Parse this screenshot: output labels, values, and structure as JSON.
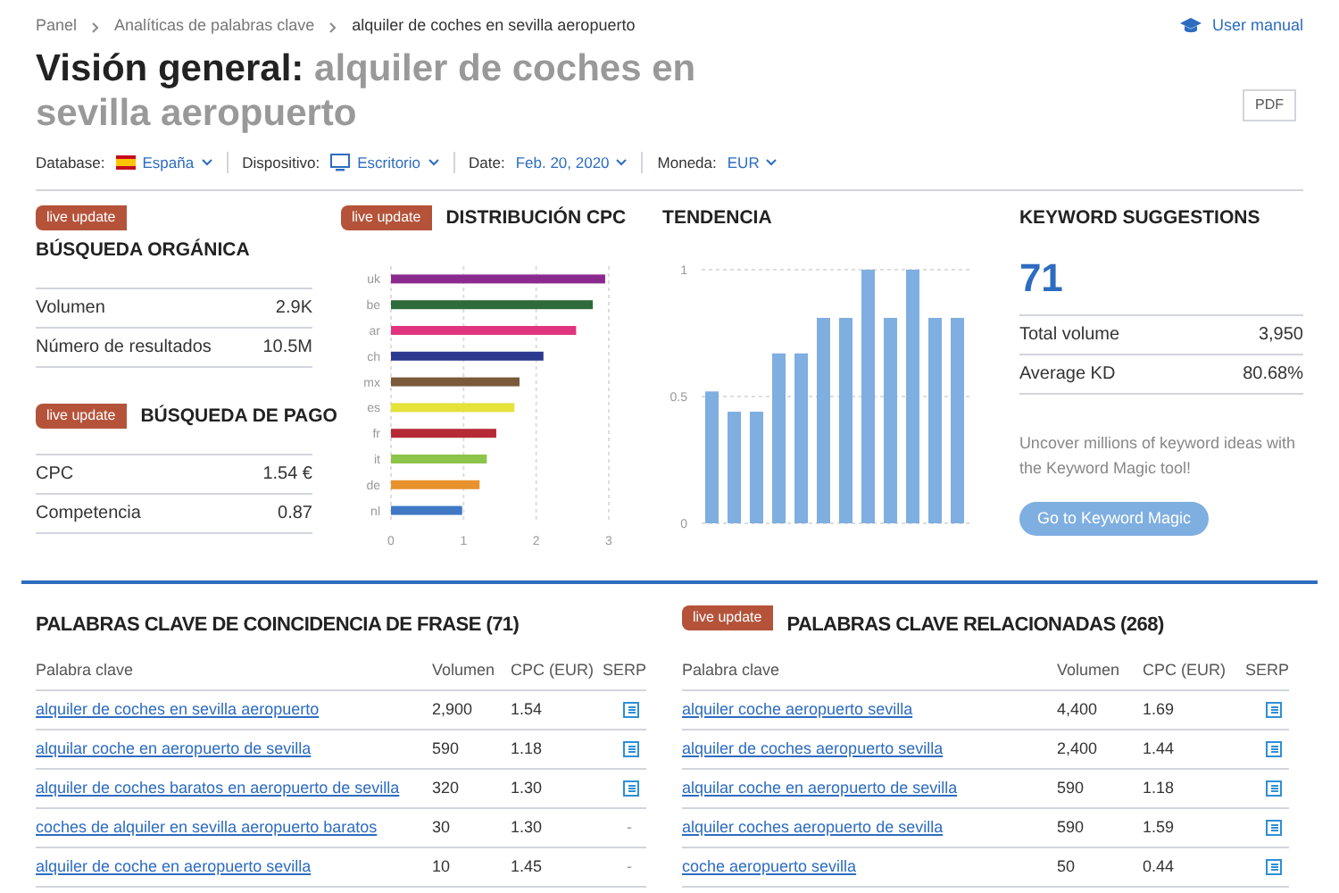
{
  "breadcrumb": [
    "Panel",
    "Analíticas de palabras clave",
    "alquiler de coches en sevilla aeropuerto"
  ],
  "user_manual": "User manual",
  "title": {
    "prefix": "Visión general:",
    "keyword": "alquiler de coches en sevilla aeropuerto"
  },
  "pdf_button": "PDF",
  "filters": [
    {
      "label": "Database:",
      "value": "España",
      "kind": "flag"
    },
    {
      "label": "Dispositivo:",
      "value": "Escritorio",
      "kind": "desktop"
    },
    {
      "label": "Date:",
      "value": "Feb. 20, 2020",
      "kind": "plain"
    },
    {
      "label": "Moneda:",
      "value": "EUR",
      "kind": "plain"
    }
  ],
  "organic": {
    "badge": "live update",
    "title": "BÚSQUEDA ORGÁNICA",
    "rows": [
      {
        "label": "Volumen",
        "value": "2.9K"
      },
      {
        "label": "Número de resultados",
        "value": "10.5M"
      }
    ]
  },
  "paid": {
    "badge": "live update",
    "title": "BÚSQUEDA DE PAGO",
    "rows": [
      {
        "label": "CPC",
        "value": "1.54 €"
      },
      {
        "label": "Competencia",
        "value": "0.87"
      }
    ]
  },
  "cpc_distribution": {
    "badge": "live update",
    "title": "DISTRIBUCIÓN CPC",
    "chart_data": {
      "type": "bar",
      "orientation": "horizontal",
      "categories": [
        "uk",
        "be",
        "ar",
        "ch",
        "mx",
        "es",
        "fr",
        "it",
        "de",
        "nl"
      ],
      "series": [
        {
          "values": [
            2.95,
            2.78,
            2.55,
            2.1,
            1.77,
            1.7,
            1.45,
            1.32,
            1.22,
            0.98
          ]
        }
      ],
      "colors": [
        "#8b2a8e",
        "#2e6b3a",
        "#e0357e",
        "#2b3a8f",
        "#7a5a3a",
        "#e5e23a",
        "#b52a35",
        "#8dc44a",
        "#e8922e",
        "#3f78c4"
      ],
      "xlim": [
        0,
        3
      ],
      "xticks": [
        0,
        1,
        2,
        3
      ]
    }
  },
  "trend": {
    "title": "TENDENCIA",
    "chart_data": {
      "type": "bar",
      "series": [
        {
          "color": "#7faee0",
          "values": [
            0.52,
            0.44,
            0.44,
            0.67,
            0.67,
            0.81,
            0.81,
            1,
            0.81,
            1,
            0.81,
            0.81
          ]
        }
      ],
      "ylim": [
        0,
        1
      ],
      "yticks": [
        0,
        0.5,
        1
      ]
    }
  },
  "keyword_suggestions": {
    "title": "KEYWORD SUGGESTIONS",
    "count": "71",
    "rows": [
      {
        "label": "Total volume",
        "value": "3,950"
      },
      {
        "label": "Average KD",
        "value": "80.68%"
      }
    ],
    "text": "Uncover millions of keyword ideas with the Keyword Magic tool!",
    "button": "Go to Keyword Magic"
  },
  "phrase_match": {
    "title": "PALABRAS CLAVE DE COINCIDENCIA DE FRASE (71)",
    "columns": [
      "Palabra clave",
      "Volumen",
      "CPC (EUR)",
      "SERP"
    ],
    "rows": [
      {
        "keyword": "alquiler de coches en sevilla aeropuerto",
        "volume": "2,900",
        "cpc": "1.54",
        "serp_link": true
      },
      {
        "keyword": "alquilar coche en aeropuerto de sevilla",
        "volume": "590",
        "cpc": "1.18",
        "serp_link": true
      },
      {
        "keyword": "alquiler de coches baratos en aeropuerto de sevilla",
        "volume": "320",
        "cpc": "1.30",
        "serp_link": true
      },
      {
        "keyword": "coches de alquiler en sevilla aeropuerto baratos",
        "volume": "30",
        "cpc": "1.30",
        "serp_link": false,
        "serp_text": "-"
      },
      {
        "keyword": "alquiler de coche en aeropuerto sevilla",
        "volume": "10",
        "cpc": "1.45",
        "serp_link": false,
        "serp_text": "-"
      }
    ]
  },
  "related": {
    "badge": "live update",
    "title": "PALABRAS CLAVE RELACIONADAS (268)",
    "columns": [
      "Palabra clave",
      "Volumen",
      "CPC (EUR)",
      "SERP"
    ],
    "rows": [
      {
        "keyword": "alquiler coche aeropuerto sevilla",
        "volume": "4,400",
        "cpc": "1.69",
        "serp_link": true
      },
      {
        "keyword": "alquiler de coches aeropuerto sevilla",
        "volume": "2,400",
        "cpc": "1.44",
        "serp_link": true
      },
      {
        "keyword": "alquilar coche en aeropuerto de sevilla",
        "volume": "590",
        "cpc": "1.18",
        "serp_link": true
      },
      {
        "keyword": "alquiler coches aeropuerto de sevilla",
        "volume": "590",
        "cpc": "1.59",
        "serp_link": true
      },
      {
        "keyword": "coche aeropuerto sevilla",
        "volume": "50",
        "cpc": "0.44",
        "serp_link": true
      }
    ]
  }
}
